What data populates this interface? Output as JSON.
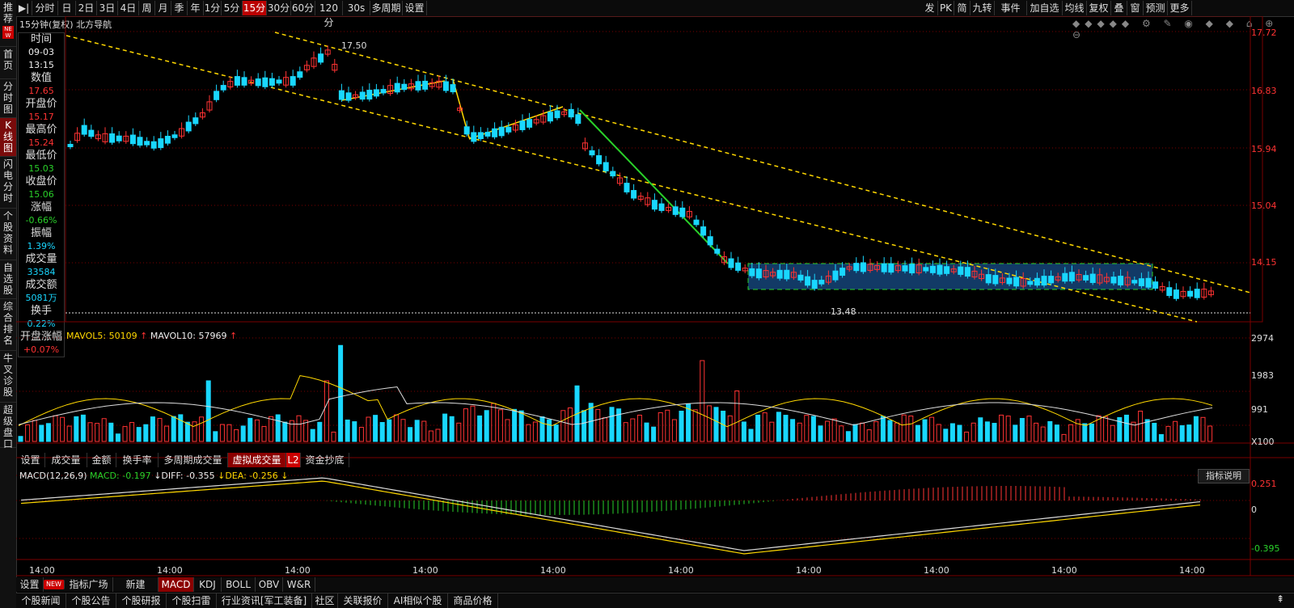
{
  "left_nav": [
    {
      "label": "推荐",
      "tag": "NEW"
    },
    {
      "label": "首页"
    },
    {
      "label": "分时图"
    },
    {
      "label": "K线图",
      "active": true
    },
    {
      "label": "闪电分时"
    },
    {
      "label": "个股资料"
    },
    {
      "label": "自选股"
    },
    {
      "label": "综合排名"
    },
    {
      "label": "牛叉诊股"
    },
    {
      "label": "超级盘口"
    }
  ],
  "toolbar_left": [
    "分时",
    "日",
    "2日",
    "3日",
    "4日",
    "周",
    "月",
    "季",
    "年",
    "1分",
    "5分",
    "15分",
    "30分",
    "60分",
    "120分",
    "30s",
    "多周期",
    "设置"
  ],
  "toolbar_active": "15分",
  "toolbar_right": [
    "发",
    "PK",
    "简",
    "九转",
    "事件",
    "加自选",
    "均线",
    "复权",
    "叠",
    "窗",
    "预测",
    "更多"
  ],
  "chart_header": "15分钟(复权)  北方导航",
  "info_panel": [
    {
      "label": "时间",
      "values": [
        "09-03",
        "13:15"
      ],
      "color": "white"
    },
    {
      "label": "数值",
      "values": [
        "17.65"
      ],
      "color": "red"
    },
    {
      "label": "开盘价",
      "values": [
        "15.17"
      ],
      "color": "red"
    },
    {
      "label": "最高价",
      "values": [
        "15.24"
      ],
      "color": "red"
    },
    {
      "label": "最低价",
      "values": [
        "15.03"
      ],
      "color": "green"
    },
    {
      "label": "收盘价",
      "values": [
        "15.06"
      ],
      "color": "green"
    },
    {
      "label": "涨幅",
      "values": [
        "-0.66%"
      ],
      "color": "green"
    },
    {
      "label": "振幅",
      "values": [
        "1.39%"
      ],
      "color": "cyan"
    },
    {
      "label": "成交量",
      "values": [
        "33584"
      ],
      "color": "cyan"
    },
    {
      "label": "成交额",
      "values": [
        "5081万"
      ],
      "color": "cyan"
    },
    {
      "label": "换手",
      "values": [
        "0.22%"
      ],
      "color": "cyan"
    },
    {
      "label": "开盘涨幅",
      "values": [
        "+0.07%"
      ],
      "color": "red"
    }
  ],
  "price_axis": [
    "17.72",
    "16.83",
    "15.94",
    "15.04",
    "14.15"
  ],
  "price_annotations": {
    "high": "17.50",
    "low": "13.48"
  },
  "volume_header": {
    "mavol5": "MAVOL5: 50109",
    "mavol10": "MAVOL10: 57969"
  },
  "volume_axis": [
    "2974",
    "1983",
    "991",
    "X100"
  ],
  "volume_tabs": [
    "设置",
    "成交量",
    "金额",
    "换手率",
    "多周期成交量",
    "虚拟成交量",
    "L2",
    "资金抄底"
  ],
  "volume_tabs_active": "虚拟成交量",
  "macd_header": {
    "title": "MACD(12,26,9)",
    "macd": "MACD: -0.197",
    "diff": "DIFF: -0.355",
    "dea": "DEA: -0.256"
  },
  "macd_button": "指标说明",
  "macd_axis": [
    "0.251",
    "0",
    "-0.395"
  ],
  "x_axis": [
    "14:00",
    "14:00",
    "14:00",
    "14:00",
    "14:00",
    "14:00",
    "14:00",
    "14:00",
    "14:00",
    "14:00"
  ],
  "indicator_tabs": [
    "设置",
    "NEW",
    "指标广场",
    "新建",
    "MACD",
    "KDJ",
    "BOLL",
    "OBV",
    "W&R"
  ],
  "indicator_active": "MACD",
  "bottom_tabs": [
    "个股新闻",
    "个股公告",
    "个股研报",
    "个股扫雷",
    "行业资讯[军工装备]",
    "社区",
    "关联报价",
    "AI相似个股",
    "商品价格"
  ],
  "colors": {
    "up": "#ff3333",
    "down": "#19d7ff",
    "trend": "#ffd800",
    "arrow": "#2ad12a",
    "box": "#1a4a7a"
  }
}
